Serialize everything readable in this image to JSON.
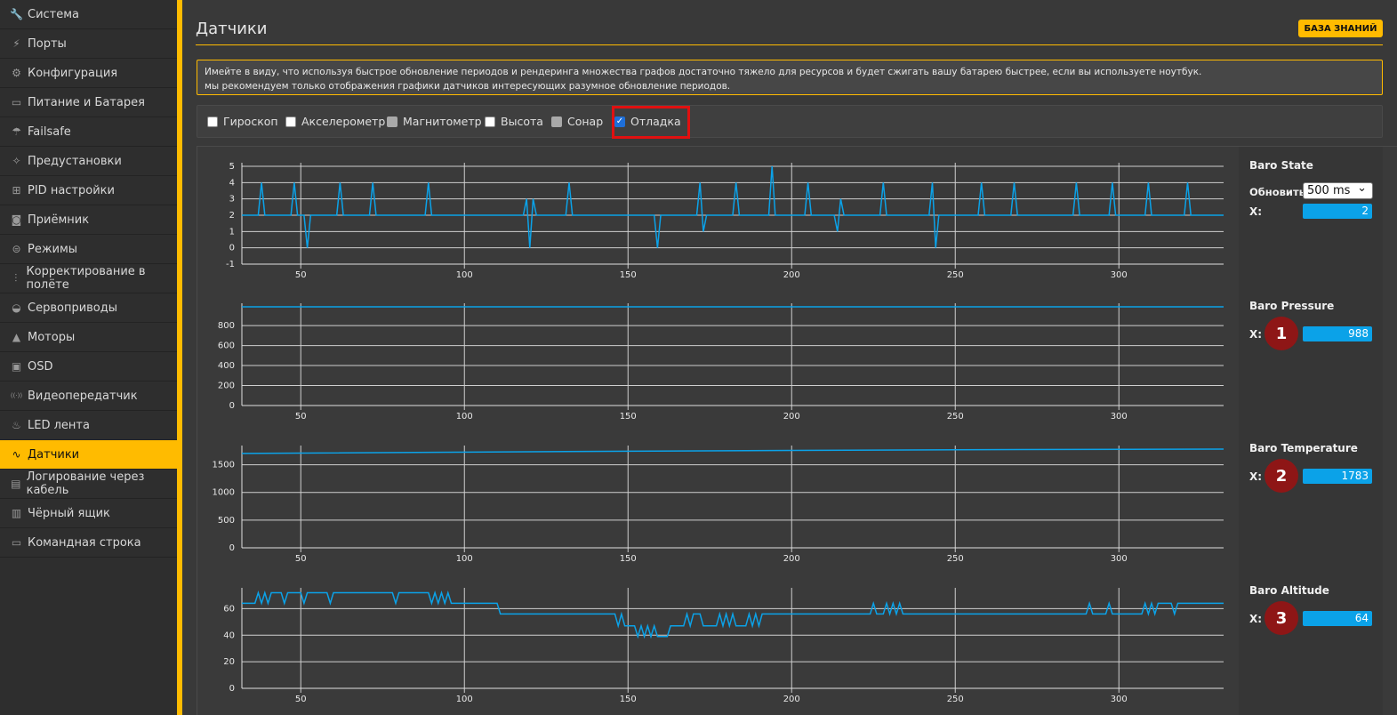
{
  "sidebar": {
    "items": [
      {
        "label": "Система",
        "icon": "wrench-icon",
        "glyph": "🔧"
      },
      {
        "label": "Порты",
        "icon": "plug-icon",
        "glyph": "⚡"
      },
      {
        "label": "Конфигурация",
        "icon": "gear-icon",
        "glyph": "⚙"
      },
      {
        "label": "Питание и Батарея",
        "icon": "battery-icon",
        "glyph": "▭"
      },
      {
        "label": "Failsafe",
        "icon": "parachute-icon",
        "glyph": "☂"
      },
      {
        "label": "Предустановки",
        "icon": "magic-wand-icon",
        "glyph": "✧"
      },
      {
        "label": "PID настройки",
        "icon": "sitemap-icon",
        "glyph": "⊞"
      },
      {
        "label": "Приёмник",
        "icon": "receiver-icon",
        "glyph": "◙"
      },
      {
        "label": "Режимы",
        "icon": "toggle-icon",
        "glyph": "⊜"
      },
      {
        "label": "Корректирование в полёте",
        "icon": "sliders-icon",
        "glyph": "⫶"
      },
      {
        "label": "Сервоприводы",
        "icon": "servo-icon",
        "glyph": "◒"
      },
      {
        "label": "Моторы",
        "icon": "motor-icon",
        "glyph": "▲"
      },
      {
        "label": "OSD",
        "icon": "osd-icon",
        "glyph": "▣"
      },
      {
        "label": "Видеопередатчик",
        "icon": "broadcast-icon",
        "glyph": "((·))"
      },
      {
        "label": "LED лента",
        "icon": "led-icon",
        "glyph": "♨"
      },
      {
        "label": "Датчики",
        "icon": "pulse-icon",
        "glyph": "∿",
        "active": true
      },
      {
        "label": "Логирование через кабель",
        "icon": "log-icon",
        "glyph": "▤"
      },
      {
        "label": "Чёрный ящик",
        "icon": "blackbox-icon",
        "glyph": "▥"
      },
      {
        "label": "Командная строка",
        "icon": "terminal-icon",
        "glyph": "▭"
      }
    ]
  },
  "header": {
    "title": "Датчики",
    "kb_button": "БАЗА ЗНАНИЙ"
  },
  "note": {
    "line1": "Имейте в виду, что используя быстрое обновление периодов и рендеринга множества графов достаточно тяжело для ресурсов и будет сжигать вашу батарею быстрее, если вы используете ноутбук.",
    "line2": "мы рекомендуем только отображения графики датчиков интересующих разумное обновление периодов."
  },
  "sensors": [
    {
      "label": "Гироскоп",
      "state": "unchecked"
    },
    {
      "label": "Акселерометр",
      "state": "unchecked"
    },
    {
      "label": "Магнитометр",
      "state": "disabled"
    },
    {
      "label": "Высота",
      "state": "unchecked"
    },
    {
      "label": "Сонар",
      "state": "disabled"
    },
    {
      "label": "Отладка",
      "state": "checked"
    }
  ],
  "colors": {
    "accent": "#ffbb00",
    "line": "#0ba2e8",
    "highlight": "#e01010",
    "badge": "#8e1616"
  },
  "panels": [
    {
      "title": "Baro State",
      "refresh_label": "Обновить:",
      "refresh_value": "500 ms",
      "axis_label": "X:",
      "value": "2"
    },
    {
      "title": "Baro Pressure",
      "axis_label": "X:",
      "value": "988",
      "badge": "1"
    },
    {
      "title": "Baro Temperature",
      "axis_label": "X:",
      "value": "1783",
      "badge": "2"
    },
    {
      "title": "Baro Altitude",
      "axis_label": "X:",
      "value": "64",
      "badge": "3"
    }
  ],
  "chart_data": [
    {
      "type": "line",
      "title": "Baro State",
      "x_ticks": [
        50,
        100,
        150,
        200,
        250,
        300
      ],
      "y_ticks": [
        -1,
        0,
        1,
        2,
        3,
        4,
        5
      ],
      "xlim": [
        32,
        332
      ],
      "ylim": [
        -1,
        5
      ],
      "grid": true,
      "series": [
        {
          "name": "X",
          "values": [
            {
              "x": 32,
              "y": 2
            },
            {
              "x": 37,
              "y": 2
            },
            {
              "x": 38,
              "y": 4
            },
            {
              "x": 39,
              "y": 2
            },
            {
              "x": 47,
              "y": 2
            },
            {
              "x": 48,
              "y": 4
            },
            {
              "x": 49,
              "y": 2
            },
            {
              "x": 51,
              "y": 2
            },
            {
              "x": 52,
              "y": 0
            },
            {
              "x": 53,
              "y": 2
            },
            {
              "x": 61,
              "y": 2
            },
            {
              "x": 62,
              "y": 4
            },
            {
              "x": 63,
              "y": 2
            },
            {
              "x": 71,
              "y": 2
            },
            {
              "x": 72,
              "y": 4
            },
            {
              "x": 73,
              "y": 2
            },
            {
              "x": 88,
              "y": 2
            },
            {
              "x": 89,
              "y": 4
            },
            {
              "x": 90,
              "y": 2
            },
            {
              "x": 118,
              "y": 2
            },
            {
              "x": 119,
              "y": 3
            },
            {
              "x": 120,
              "y": 0
            },
            {
              "x": 121,
              "y": 3
            },
            {
              "x": 122,
              "y": 2
            },
            {
              "x": 131,
              "y": 2
            },
            {
              "x": 132,
              "y": 4
            },
            {
              "x": 133,
              "y": 2
            },
            {
              "x": 158,
              "y": 2
            },
            {
              "x": 159,
              "y": 0
            },
            {
              "x": 160,
              "y": 2
            },
            {
              "x": 171,
              "y": 2
            },
            {
              "x": 172,
              "y": 4
            },
            {
              "x": 173,
              "y": 1
            },
            {
              "x": 174,
              "y": 2
            },
            {
              "x": 182,
              "y": 2
            },
            {
              "x": 183,
              "y": 4
            },
            {
              "x": 184,
              "y": 2
            },
            {
              "x": 193,
              "y": 2
            },
            {
              "x": 194,
              "y": 5
            },
            {
              "x": 195,
              "y": 2
            },
            {
              "x": 204,
              "y": 2
            },
            {
              "x": 205,
              "y": 4
            },
            {
              "x": 206,
              "y": 2
            },
            {
              "x": 213,
              "y": 2
            },
            {
              "x": 214,
              "y": 1
            },
            {
              "x": 215,
              "y": 3
            },
            {
              "x": 216,
              "y": 2
            },
            {
              "x": 227,
              "y": 2
            },
            {
              "x": 228,
              "y": 4
            },
            {
              "x": 229,
              "y": 2
            },
            {
              "x": 242,
              "y": 2
            },
            {
              "x": 243,
              "y": 4
            },
            {
              "x": 244,
              "y": 0
            },
            {
              "x": 245,
              "y": 2
            },
            {
              "x": 257,
              "y": 2
            },
            {
              "x": 258,
              "y": 4
            },
            {
              "x": 259,
              "y": 2
            },
            {
              "x": 267,
              "y": 2
            },
            {
              "x": 268,
              "y": 4
            },
            {
              "x": 269,
              "y": 2
            },
            {
              "x": 286,
              "y": 2
            },
            {
              "x": 287,
              "y": 4
            },
            {
              "x": 288,
              "y": 2
            },
            {
              "x": 297,
              "y": 2
            },
            {
              "x": 298,
              "y": 4
            },
            {
              "x": 299,
              "y": 2
            },
            {
              "x": 308,
              "y": 2
            },
            {
              "x": 309,
              "y": 4
            },
            {
              "x": 310,
              "y": 2
            },
            {
              "x": 320,
              "y": 2
            },
            {
              "x": 321,
              "y": 4
            },
            {
              "x": 322,
              "y": 2
            },
            {
              "x": 332,
              "y": 2
            }
          ]
        }
      ]
    },
    {
      "type": "line",
      "title": "Baro Pressure",
      "x_ticks": [
        50,
        100,
        150,
        200,
        250,
        300
      ],
      "y_ticks": [
        0,
        200,
        400,
        600,
        800
      ],
      "xlim": [
        32,
        332
      ],
      "ylim": [
        0,
        988
      ],
      "grid": true,
      "series": [
        {
          "name": "X",
          "values": [
            {
              "x": 32,
              "y": 988
            },
            {
              "x": 332,
              "y": 988
            }
          ]
        }
      ]
    },
    {
      "type": "line",
      "title": "Baro Temperature",
      "x_ticks": [
        50,
        100,
        150,
        200,
        250,
        300
      ],
      "y_ticks": [
        0,
        500,
        1000,
        1500
      ],
      "xlim": [
        32,
        332
      ],
      "ylim": [
        0,
        1783
      ],
      "grid": true,
      "series": [
        {
          "name": "X",
          "values": [
            {
              "x": 32,
              "y": 1705
            },
            {
              "x": 150,
              "y": 1745
            },
            {
              "x": 250,
              "y": 1772
            },
            {
              "x": 332,
              "y": 1783
            }
          ]
        }
      ]
    },
    {
      "type": "line",
      "title": "Baro Altitude",
      "x_ticks": [
        50,
        100,
        150,
        200,
        250,
        300
      ],
      "y_ticks": [
        0,
        20,
        40,
        60
      ],
      "xlim": [
        32,
        332
      ],
      "ylim": [
        0,
        73
      ],
      "grid": true,
      "series": [
        {
          "name": "X",
          "values": [
            {
              "x": 32,
              "y": 64
            },
            {
              "x": 36,
              "y": 64
            },
            {
              "x": 37,
              "y": 72
            },
            {
              "x": 38,
              "y": 64
            },
            {
              "x": 39,
              "y": 72
            },
            {
              "x": 40,
              "y": 64
            },
            {
              "x": 41,
              "y": 72
            },
            {
              "x": 44,
              "y": 72
            },
            {
              "x": 45,
              "y": 64
            },
            {
              "x": 46,
              "y": 72
            },
            {
              "x": 50,
              "y": 72
            },
            {
              "x": 51,
              "y": 64
            },
            {
              "x": 52,
              "y": 72
            },
            {
              "x": 58,
              "y": 72
            },
            {
              "x": 59,
              "y": 64
            },
            {
              "x": 60,
              "y": 72
            },
            {
              "x": 78,
              "y": 72
            },
            {
              "x": 79,
              "y": 64
            },
            {
              "x": 80,
              "y": 72
            },
            {
              "x": 89,
              "y": 72
            },
            {
              "x": 90,
              "y": 64
            },
            {
              "x": 91,
              "y": 72
            },
            {
              "x": 92,
              "y": 64
            },
            {
              "x": 93,
              "y": 72
            },
            {
              "x": 94,
              "y": 64
            },
            {
              "x": 95,
              "y": 72
            },
            {
              "x": 96,
              "y": 64
            },
            {
              "x": 110,
              "y": 64
            },
            {
              "x": 111,
              "y": 56
            },
            {
              "x": 146,
              "y": 56
            },
            {
              "x": 147,
              "y": 47
            },
            {
              "x": 148,
              "y": 56
            },
            {
              "x": 149,
              "y": 47
            },
            {
              "x": 152,
              "y": 47
            },
            {
              "x": 153,
              "y": 39
            },
            {
              "x": 154,
              "y": 47
            },
            {
              "x": 155,
              "y": 39
            },
            {
              "x": 156,
              "y": 47
            },
            {
              "x": 157,
              "y": 39
            },
            {
              "x": 158,
              "y": 47
            },
            {
              "x": 159,
              "y": 39
            },
            {
              "x": 162,
              "y": 39
            },
            {
              "x": 163,
              "y": 47
            },
            {
              "x": 167,
              "y": 47
            },
            {
              "x": 168,
              "y": 56
            },
            {
              "x": 169,
              "y": 47
            },
            {
              "x": 170,
              "y": 56
            },
            {
              "x": 172,
              "y": 56
            },
            {
              "x": 173,
              "y": 47
            },
            {
              "x": 177,
              "y": 47
            },
            {
              "x": 178,
              "y": 56
            },
            {
              "x": 179,
              "y": 47
            },
            {
              "x": 180,
              "y": 56
            },
            {
              "x": 181,
              "y": 47
            },
            {
              "x": 182,
              "y": 56
            },
            {
              "x": 183,
              "y": 47
            },
            {
              "x": 186,
              "y": 47
            },
            {
              "x": 187,
              "y": 56
            },
            {
              "x": 188,
              "y": 47
            },
            {
              "x": 189,
              "y": 56
            },
            {
              "x": 190,
              "y": 47
            },
            {
              "x": 191,
              "y": 56
            },
            {
              "x": 224,
              "y": 56
            },
            {
              "x": 225,
              "y": 64
            },
            {
              "x": 226,
              "y": 56
            },
            {
              "x": 228,
              "y": 56
            },
            {
              "x": 229,
              "y": 64
            },
            {
              "x": 230,
              "y": 56
            },
            {
              "x": 231,
              "y": 64
            },
            {
              "x": 232,
              "y": 56
            },
            {
              "x": 233,
              "y": 64
            },
            {
              "x": 234,
              "y": 56
            },
            {
              "x": 290,
              "y": 56
            },
            {
              "x": 291,
              "y": 64
            },
            {
              "x": 292,
              "y": 56
            },
            {
              "x": 296,
              "y": 56
            },
            {
              "x": 297,
              "y": 64
            },
            {
              "x": 298,
              "y": 56
            },
            {
              "x": 307,
              "y": 56
            },
            {
              "x": 308,
              "y": 64
            },
            {
              "x": 309,
              "y": 56
            },
            {
              "x": 310,
              "y": 64
            },
            {
              "x": 311,
              "y": 56
            },
            {
              "x": 312,
              "y": 64
            },
            {
              "x": 316,
              "y": 64
            },
            {
              "x": 317,
              "y": 56
            },
            {
              "x": 318,
              "y": 64
            },
            {
              "x": 332,
              "y": 64
            }
          ]
        }
      ]
    }
  ]
}
